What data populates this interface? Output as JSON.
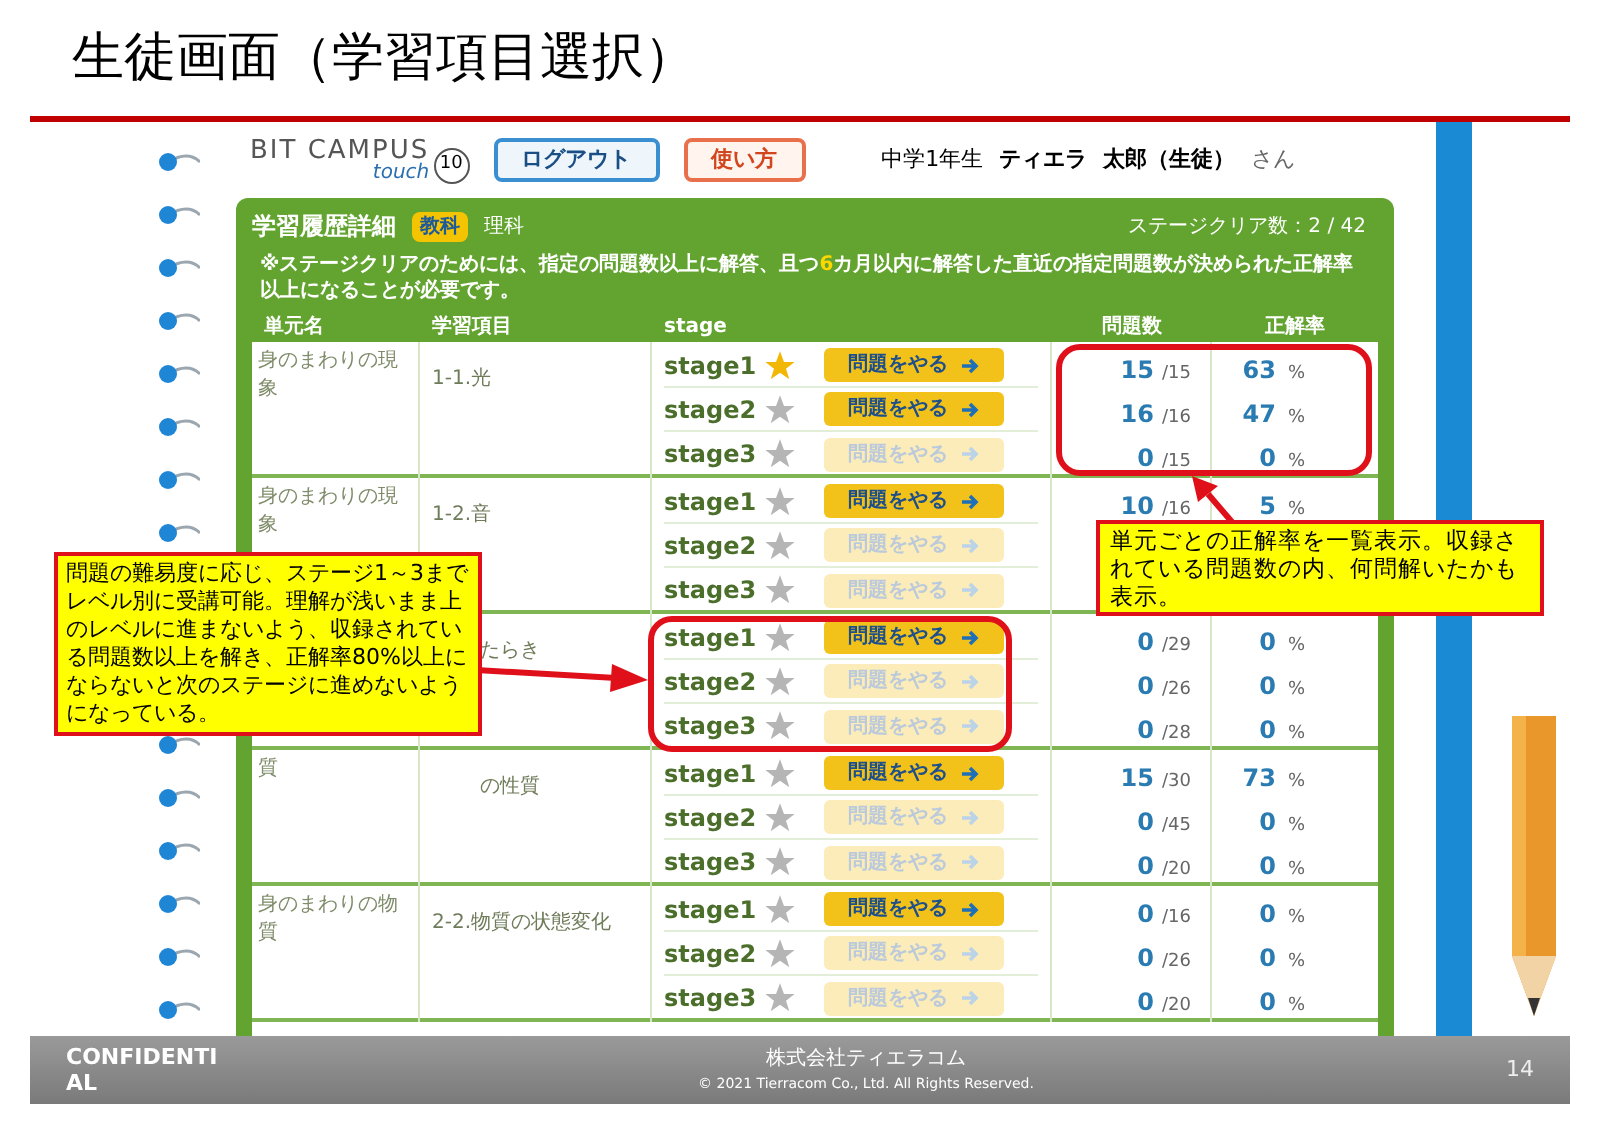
{
  "slide": {
    "title": "生徒画面（学習項目選択）"
  },
  "app": {
    "logo": {
      "name": "BIT CAMPUS",
      "sub": "touch",
      "version": "10"
    },
    "buttons": [
      {
        "label": "ログアウト",
        "kind": "logout"
      },
      {
        "label": "使い方",
        "kind": "help"
      }
    ],
    "user": {
      "grade": "中学1年生",
      "school": "ティエラ",
      "name": "太郎（生徒）",
      "suffix": "さん"
    },
    "panel": {
      "title": "学習履歴詳細",
      "badge": "教科",
      "subject": "理科",
      "clear_count": "ステージクリア数：2 / 42",
      "notice": {
        "before": "※ステージクリアのためには、指定の問題数以上に解答、且つ",
        "highlight": "6",
        "after": "カ月以内に解答した直近の指定問題数が決められた正解率以上になることが必要です。"
      }
    },
    "table": {
      "columns": [
        "単元名",
        "学習項目",
        "stage",
        "問題数",
        "正解率"
      ],
      "units": [
        {
          "unit": "身のまわりの現象",
          "item": "1-1.光",
          "cut": false,
          "stages": [
            {
              "label": "stage1",
              "starred": true,
              "button": "問題をやる",
              "enabled": true,
              "answered": "15",
              "total": "/15",
              "rate": "63",
              "percent": "%"
            },
            {
              "label": "stage2",
              "starred": false,
              "button": "問題をやる",
              "enabled": true,
              "answered": "16",
              "total": "/16",
              "rate": "47",
              "percent": "%"
            },
            {
              "label": "stage3",
              "starred": false,
              "button": "問題をやる",
              "enabled": false,
              "answered": "0",
              "total": "/15",
              "rate": "0",
              "percent": "%"
            }
          ]
        },
        {
          "unit": "身のまわりの現象",
          "item": "1-2.音",
          "cut": false,
          "stages": [
            {
              "label": "stage1",
              "starred": false,
              "button": "問題をやる",
              "enabled": true,
              "answered": "10",
              "total": "/16",
              "rate": "5",
              "percent": "%"
            },
            {
              "label": "stage2",
              "starred": false,
              "button": "問題をやる",
              "enabled": false
            },
            {
              "label": "stage3",
              "starred": false,
              "button": "問題をやる",
              "enabled": false
            }
          ]
        },
        {
          "item": "たらき",
          "cut": true,
          "stages": [
            {
              "label": "stage1",
              "starred": false,
              "button": "問題をやる",
              "enabled": true,
              "answered": "0",
              "total": "/29",
              "rate": "0",
              "percent": "%"
            },
            {
              "label": "stage2",
              "starred": false,
              "button": "問題をやる",
              "enabled": false,
              "answered": "0",
              "total": "/26",
              "rate": "0",
              "percent": "%"
            },
            {
              "label": "stage3",
              "starred": false,
              "button": "問題をやる",
              "enabled": false,
              "answered": "0",
              "total": "/28",
              "rate": "0",
              "percent": "%"
            }
          ]
        },
        {
          "unit": "質",
          "item": "の性質",
          "cut": true,
          "stages": [
            {
              "label": "stage1",
              "starred": false,
              "button": "問題をやる",
              "enabled": true,
              "answered": "15",
              "total": "/30",
              "rate": "73",
              "percent": "%"
            },
            {
              "label": "stage2",
              "starred": false,
              "button": "問題をやる",
              "enabled": false,
              "answered": "0",
              "total": "/45",
              "rate": "0",
              "percent": "%"
            },
            {
              "label": "stage3",
              "starred": false,
              "button": "問題をやる",
              "enabled": false,
              "answered": "0",
              "total": "/20",
              "rate": "0",
              "percent": "%"
            }
          ]
        },
        {
          "unit": "身のまわりの物質",
          "item": "2-2.物質の状態変化",
          "cut": false,
          "stages": [
            {
              "label": "stage1",
              "starred": false,
              "button": "問題をやる",
              "enabled": true,
              "answered": "0",
              "total": "/16",
              "rate": "0",
              "percent": "%"
            },
            {
              "label": "stage2",
              "starred": false,
              "button": "問題をやる",
              "enabled": false,
              "answered": "0",
              "total": "/26",
              "rate": "0",
              "percent": "%"
            },
            {
              "label": "stage3",
              "starred": false,
              "button": "問題をやる",
              "enabled": false,
              "answered": "0",
              "total": "/20",
              "rate": "0",
              "percent": "%"
            }
          ]
        }
      ]
    }
  },
  "callouts": [
    {
      "kind": "left",
      "text": "問題の難易度に応じ、ステージ1～3までレベル別に受講可能。理解が浅いまま上のレベルに進まないよう、収録されている問題数以上を解き、正解率80%以上にならないと次のステージに進めないようになっている。"
    },
    {
      "kind": "right",
      "text": "単元ごとの正解率を一覧表示。収録されている問題数の内、何問解いたかも表示。"
    }
  ],
  "footer": {
    "confidential": "CONFIDENTIAL",
    "company": "株式会社ティエラコム",
    "copyright": "© 2021  Tierracom Co., Ltd. All Rights Reserved.",
    "page": "14"
  }
}
